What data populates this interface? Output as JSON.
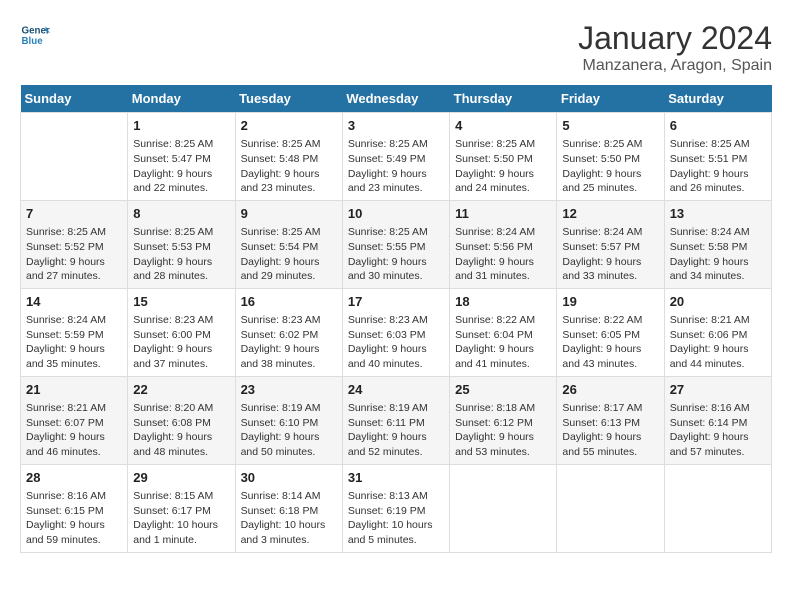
{
  "header": {
    "logo_line1": "General",
    "logo_line2": "Blue",
    "title": "January 2024",
    "subtitle": "Manzanera, Aragon, Spain"
  },
  "days_of_week": [
    "Sunday",
    "Monday",
    "Tuesday",
    "Wednesday",
    "Thursday",
    "Friday",
    "Saturday"
  ],
  "weeks": [
    [
      {
        "day": "",
        "info": ""
      },
      {
        "day": "1",
        "info": "Sunrise: 8:25 AM\nSunset: 5:47 PM\nDaylight: 9 hours\nand 22 minutes."
      },
      {
        "day": "2",
        "info": "Sunrise: 8:25 AM\nSunset: 5:48 PM\nDaylight: 9 hours\nand 23 minutes."
      },
      {
        "day": "3",
        "info": "Sunrise: 8:25 AM\nSunset: 5:49 PM\nDaylight: 9 hours\nand 23 minutes."
      },
      {
        "day": "4",
        "info": "Sunrise: 8:25 AM\nSunset: 5:50 PM\nDaylight: 9 hours\nand 24 minutes."
      },
      {
        "day": "5",
        "info": "Sunrise: 8:25 AM\nSunset: 5:50 PM\nDaylight: 9 hours\nand 25 minutes."
      },
      {
        "day": "6",
        "info": "Sunrise: 8:25 AM\nSunset: 5:51 PM\nDaylight: 9 hours\nand 26 minutes."
      }
    ],
    [
      {
        "day": "7",
        "info": "Sunrise: 8:25 AM\nSunset: 5:52 PM\nDaylight: 9 hours\nand 27 minutes."
      },
      {
        "day": "8",
        "info": "Sunrise: 8:25 AM\nSunset: 5:53 PM\nDaylight: 9 hours\nand 28 minutes."
      },
      {
        "day": "9",
        "info": "Sunrise: 8:25 AM\nSunset: 5:54 PM\nDaylight: 9 hours\nand 29 minutes."
      },
      {
        "day": "10",
        "info": "Sunrise: 8:25 AM\nSunset: 5:55 PM\nDaylight: 9 hours\nand 30 minutes."
      },
      {
        "day": "11",
        "info": "Sunrise: 8:24 AM\nSunset: 5:56 PM\nDaylight: 9 hours\nand 31 minutes."
      },
      {
        "day": "12",
        "info": "Sunrise: 8:24 AM\nSunset: 5:57 PM\nDaylight: 9 hours\nand 33 minutes."
      },
      {
        "day": "13",
        "info": "Sunrise: 8:24 AM\nSunset: 5:58 PM\nDaylight: 9 hours\nand 34 minutes."
      }
    ],
    [
      {
        "day": "14",
        "info": "Sunrise: 8:24 AM\nSunset: 5:59 PM\nDaylight: 9 hours\nand 35 minutes."
      },
      {
        "day": "15",
        "info": "Sunrise: 8:23 AM\nSunset: 6:00 PM\nDaylight: 9 hours\nand 37 minutes."
      },
      {
        "day": "16",
        "info": "Sunrise: 8:23 AM\nSunset: 6:02 PM\nDaylight: 9 hours\nand 38 minutes."
      },
      {
        "day": "17",
        "info": "Sunrise: 8:23 AM\nSunset: 6:03 PM\nDaylight: 9 hours\nand 40 minutes."
      },
      {
        "day": "18",
        "info": "Sunrise: 8:22 AM\nSunset: 6:04 PM\nDaylight: 9 hours\nand 41 minutes."
      },
      {
        "day": "19",
        "info": "Sunrise: 8:22 AM\nSunset: 6:05 PM\nDaylight: 9 hours\nand 43 minutes."
      },
      {
        "day": "20",
        "info": "Sunrise: 8:21 AM\nSunset: 6:06 PM\nDaylight: 9 hours\nand 44 minutes."
      }
    ],
    [
      {
        "day": "21",
        "info": "Sunrise: 8:21 AM\nSunset: 6:07 PM\nDaylight: 9 hours\nand 46 minutes."
      },
      {
        "day": "22",
        "info": "Sunrise: 8:20 AM\nSunset: 6:08 PM\nDaylight: 9 hours\nand 48 minutes."
      },
      {
        "day": "23",
        "info": "Sunrise: 8:19 AM\nSunset: 6:10 PM\nDaylight: 9 hours\nand 50 minutes."
      },
      {
        "day": "24",
        "info": "Sunrise: 8:19 AM\nSunset: 6:11 PM\nDaylight: 9 hours\nand 52 minutes."
      },
      {
        "day": "25",
        "info": "Sunrise: 8:18 AM\nSunset: 6:12 PM\nDaylight: 9 hours\nand 53 minutes."
      },
      {
        "day": "26",
        "info": "Sunrise: 8:17 AM\nSunset: 6:13 PM\nDaylight: 9 hours\nand 55 minutes."
      },
      {
        "day": "27",
        "info": "Sunrise: 8:16 AM\nSunset: 6:14 PM\nDaylight: 9 hours\nand 57 minutes."
      }
    ],
    [
      {
        "day": "28",
        "info": "Sunrise: 8:16 AM\nSunset: 6:15 PM\nDaylight: 9 hours\nand 59 minutes."
      },
      {
        "day": "29",
        "info": "Sunrise: 8:15 AM\nSunset: 6:17 PM\nDaylight: 10 hours\nand 1 minute."
      },
      {
        "day": "30",
        "info": "Sunrise: 8:14 AM\nSunset: 6:18 PM\nDaylight: 10 hours\nand 3 minutes."
      },
      {
        "day": "31",
        "info": "Sunrise: 8:13 AM\nSunset: 6:19 PM\nDaylight: 10 hours\nand 5 minutes."
      },
      {
        "day": "",
        "info": ""
      },
      {
        "day": "",
        "info": ""
      },
      {
        "day": "",
        "info": ""
      }
    ]
  ]
}
